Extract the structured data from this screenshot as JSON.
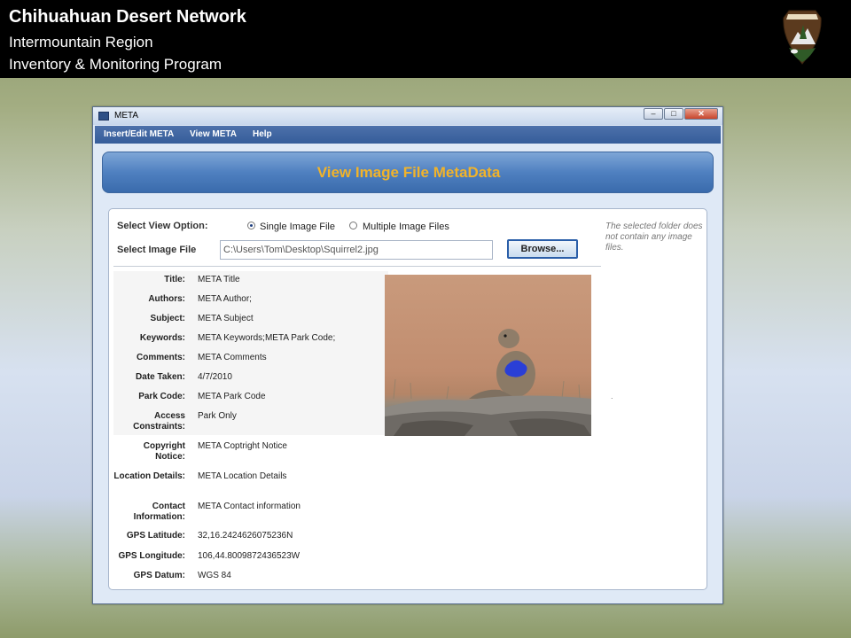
{
  "header": {
    "title": "Chihuahuan Desert Network",
    "subtitle": "Intermountain Region",
    "program": "Inventory & Monitoring Program"
  },
  "window": {
    "title": "META",
    "controls": {
      "minimize": "–",
      "maximize": "□",
      "close": "✕"
    }
  },
  "menu": {
    "items": [
      {
        "label": "Insert/Edit META"
      },
      {
        "label": "View META"
      },
      {
        "label": "Help"
      }
    ]
  },
  "banner": {
    "title": "View Image File MetaData"
  },
  "view_option": {
    "label": "Select View Option:",
    "options": [
      {
        "label": "Single Image File",
        "selected": true
      },
      {
        "label": "Multiple Image Files",
        "selected": false
      }
    ]
  },
  "image_file": {
    "label": "Select Image File",
    "value": "C:\\Users\\Tom\\Desktop\\Squirrel2.jpg",
    "browse_label": "Browse..."
  },
  "note": "The selected folder does not contain any image files.",
  "dot": ".",
  "metadata": [
    {
      "label": "Title:",
      "value": "META Title"
    },
    {
      "label": "Authors:",
      "value": "META Author;"
    },
    {
      "label": "Subject:",
      "value": "META Subject"
    },
    {
      "label": "Keywords:",
      "value": "META Keywords;META Park Code;"
    },
    {
      "label": "Comments:",
      "value": "META Comments"
    },
    {
      "label": "Date Taken:",
      "value": "4/7/2010"
    },
    {
      "label": "Park Code:",
      "value": "META Park Code"
    },
    {
      "label": "Access Constraints:",
      "value": "Park Only"
    },
    {
      "label": "Copyright Notice:",
      "value": "META Coptright Notice"
    },
    {
      "label": "Location Details:",
      "value": "META Location Details"
    },
    {
      "label": "Contact Information:",
      "value": "META Contact information"
    },
    {
      "label": "GPS Latitude:",
      "value": "32,16.2424626075236N"
    },
    {
      "label": "GPS Longitude:",
      "value": "106,44.8009872436523W"
    },
    {
      "label": "GPS Datum:",
      "value": "WGS 84"
    }
  ],
  "colors": {
    "header_bg": "#000000",
    "banner_title": "#f1b32a",
    "menubar": "#3d64a0",
    "window_bg": "#dfe9f6"
  }
}
